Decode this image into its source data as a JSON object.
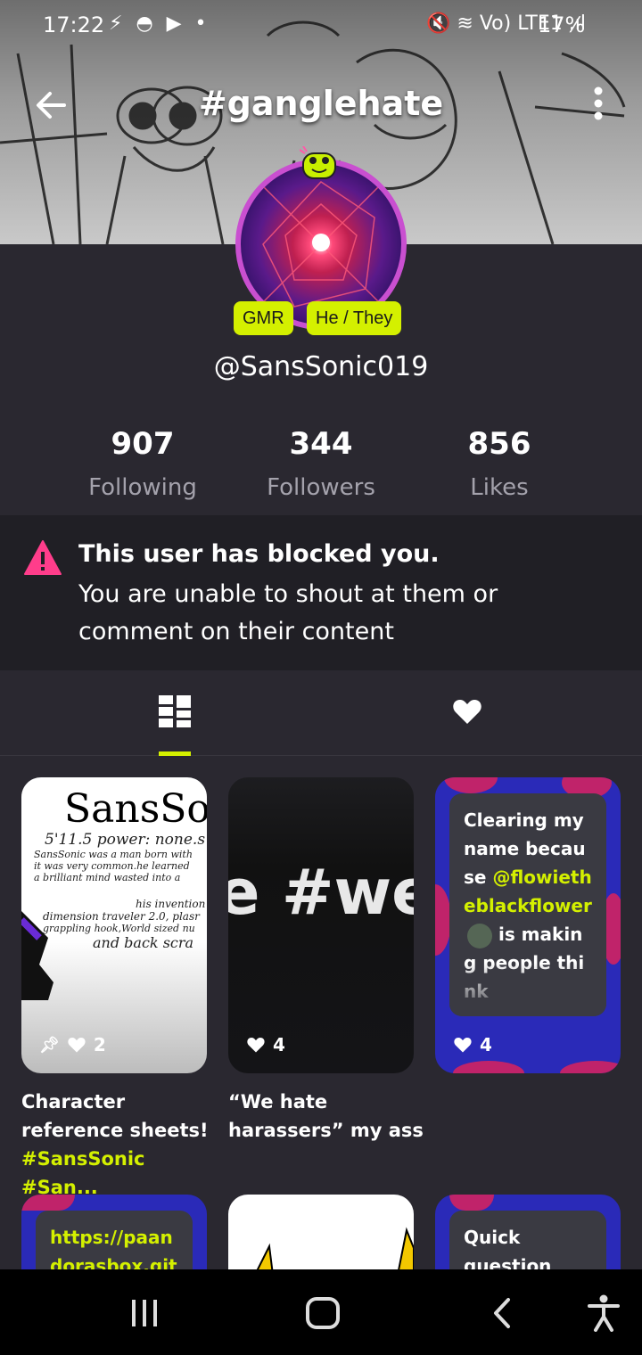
{
  "status": {
    "time": "17:22",
    "left_icons": "⚡ ◓ ▶ •",
    "right_icons": "🔇 ≋ Vo) LTE1 .ıl",
    "battery": "17%"
  },
  "header": {
    "title": "#ganglehate"
  },
  "profile": {
    "badges": [
      "GMR",
      "He / They"
    ],
    "username": "@SansSonic019",
    "stats": [
      {
        "value": "907",
        "label": "Following"
      },
      {
        "value": "344",
        "label": "Followers"
      },
      {
        "value": "856",
        "label": "Likes"
      }
    ]
  },
  "blocked": {
    "title": "This user has blocked you.",
    "text": "You are unable to shout at them or comment on their content"
  },
  "posts": [
    {
      "thumb_title": "SansSo",
      "thumb_lines": [
        "5'11.5  power: none.s",
        "SansSonic was a man born with",
        "it was very common.he learned",
        "a brilliant mind wasted into a",
        "his invention",
        "dimension traveler 2.0, plasr",
        "grappling hook,World sized nu",
        "and back scra"
      ],
      "likes": "2",
      "caption": "Character reference sheets!",
      "hashtags": "#SansSonic #San..."
    },
    {
      "thumb_text": "e #we",
      "likes": "4",
      "caption": "“We hate harassers” my ass"
    },
    {
      "text_before": "Clearing my name because ",
      "mention": "@flowietheblackflower",
      "text_after": " is making people think",
      "likes": "4"
    }
  ],
  "row2": [
    {
      "text": "https://paandorasbox.gith"
    },
    {
      "text": ""
    },
    {
      "text": "Quick question"
    }
  ],
  "colors": {
    "accent": "#d4f000",
    "background": "#2a2830",
    "warning": "#ff3d8b"
  }
}
